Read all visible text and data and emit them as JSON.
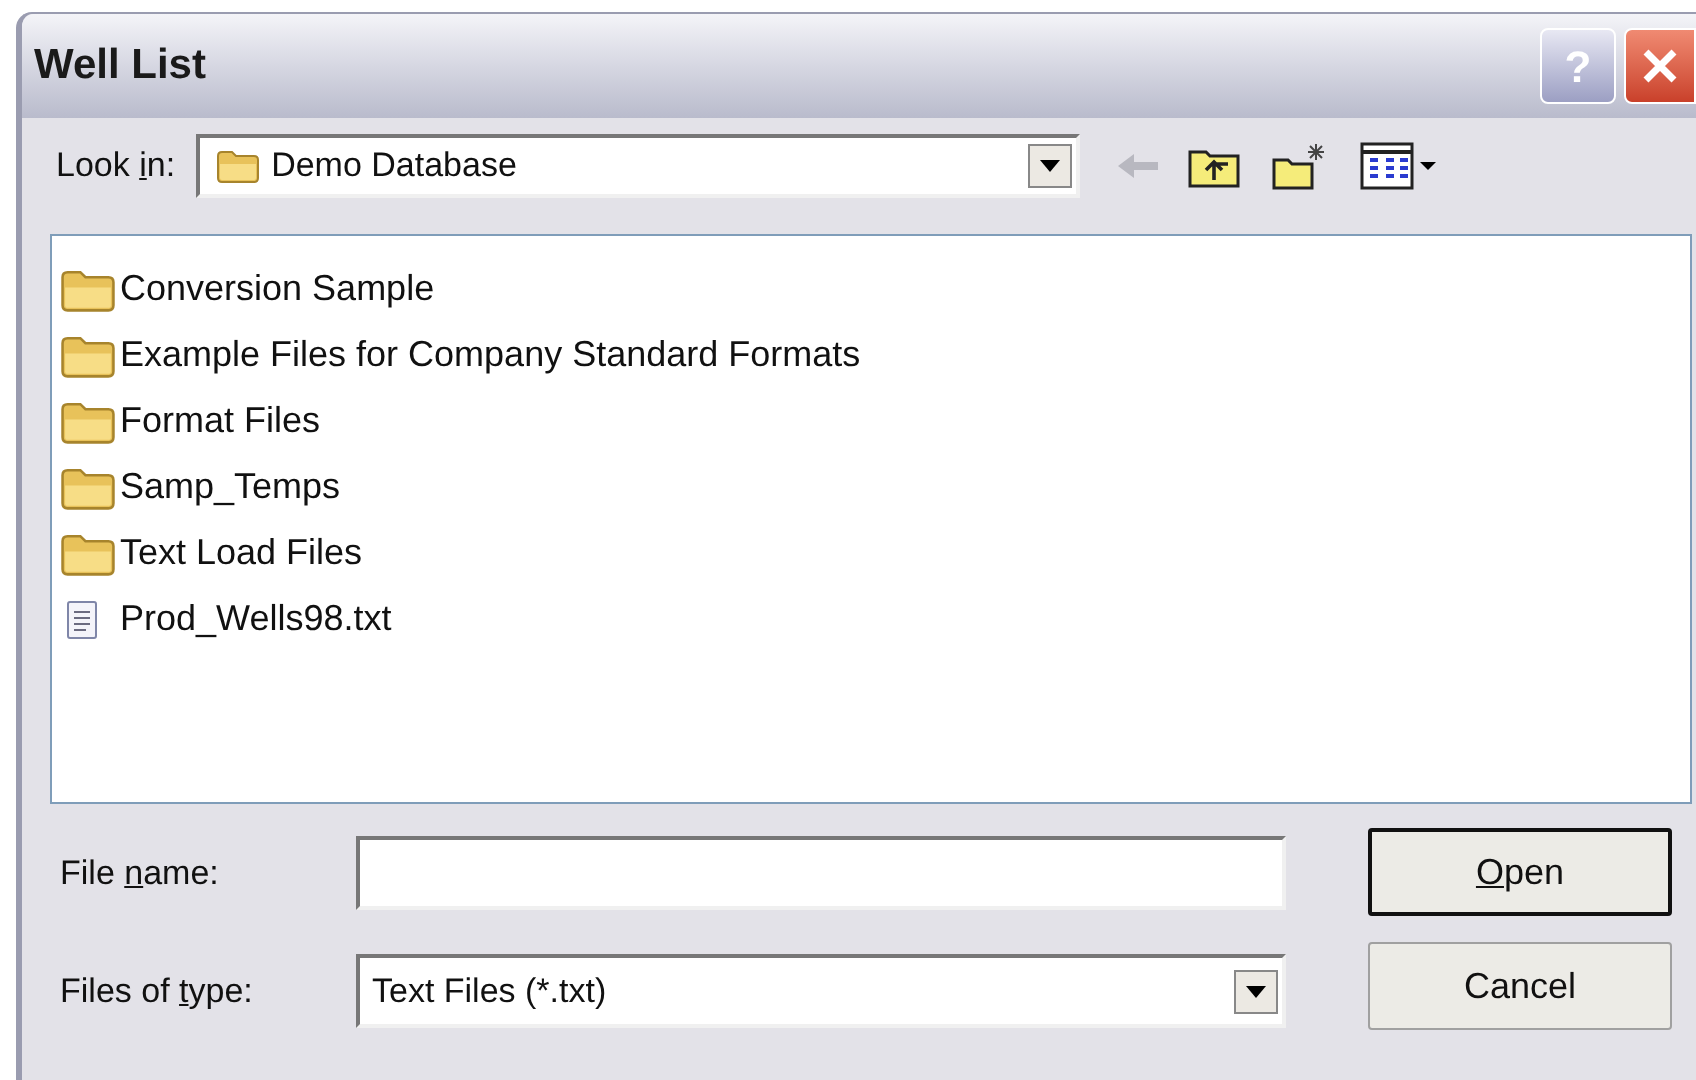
{
  "window": {
    "title": "Well List",
    "help_button": "?"
  },
  "look_in": {
    "label": {
      "before": "Look ",
      "key": "i",
      "after": "n:"
    },
    "value": "Demo Database"
  },
  "files": [
    {
      "name": "Conversion Sample",
      "kind": "folder"
    },
    {
      "name": "Example Files for Company Standard Formats",
      "kind": "folder"
    },
    {
      "name": "Format Files",
      "kind": "folder"
    },
    {
      "name": "Samp_Temps",
      "kind": "folder"
    },
    {
      "name": "Text Load Files",
      "kind": "folder"
    },
    {
      "name": "Prod_Wells98.txt",
      "kind": "file"
    }
  ],
  "file_name": {
    "label": {
      "before": "File ",
      "key": "n",
      "after": "ame:"
    }
  },
  "file_type": {
    "label": {
      "before": "Files of ",
      "key": "t",
      "after": "ype:"
    },
    "value": "Text Files (*.txt)"
  },
  "buttons": [
    {
      "label": {
        "key": "O",
        "after": "pen"
      },
      "default": true
    },
    {
      "label": {
        "before": "Cancel"
      },
      "default": false
    }
  ]
}
